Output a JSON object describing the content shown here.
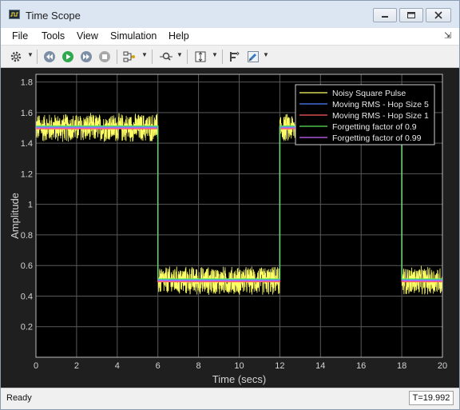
{
  "window": {
    "title": "Time Scope"
  },
  "menu": {
    "items": [
      "File",
      "Tools",
      "View",
      "Simulation",
      "Help"
    ]
  },
  "toolbar": {
    "icons": [
      "gear-icon",
      "step-back-icon",
      "run-icon",
      "step-forward-icon",
      "stop-icon",
      "signal-selector-icon",
      "zoom-icon",
      "scale-axes-icon",
      "cursor-measure-icon",
      "highlight-icon"
    ]
  },
  "status": {
    "left": "Ready",
    "time": "T=19.992"
  },
  "colors": {
    "plot_bg": "#000000",
    "panel_bg": "#1f1f1f",
    "grid": "#5a5a5a",
    "axis_text": "#d4d4d4",
    "noisy": "#ffff66",
    "rms_hop5": "#4f81ff",
    "rms_hop1": "#ff5a5a",
    "forget_09": "#5ce65c",
    "forget_099": "#cc66ff"
  },
  "chart_data": {
    "type": "line",
    "title": "",
    "xlabel": "Time (secs)",
    "ylabel": "Amplitude",
    "xlim": [
      0,
      20
    ],
    "ylim": [
      0,
      1.85
    ],
    "xticks": [
      0,
      2,
      4,
      6,
      8,
      10,
      12,
      14,
      16,
      18,
      20
    ],
    "yticks": [
      0.2,
      0.4,
      0.6,
      0.8,
      1,
      1.2,
      1.4,
      1.6,
      1.8
    ],
    "grid": true,
    "legend_position": "top-right",
    "legend_bg": "#000000",
    "noise_band": 0.1,
    "series": [
      {
        "name": "Noisy Square Pulse",
        "color": "#ffff66",
        "kind": "noisy",
        "x": [
          0,
          6,
          6,
          12,
          12,
          18,
          18,
          20
        ],
        "y": [
          1.5,
          1.5,
          0.5,
          0.5,
          1.5,
          1.5,
          0.5,
          0.5
        ]
      },
      {
        "name": "Moving RMS - Hop Size 5",
        "color": "#4f81ff",
        "kind": "line",
        "x": [
          0,
          6,
          6,
          12,
          12,
          18,
          18,
          20
        ],
        "y": [
          1.5,
          1.5,
          0.5,
          0.5,
          1.5,
          1.5,
          0.5,
          0.5
        ]
      },
      {
        "name": "Moving RMS - Hop Size 1",
        "color": "#ff5a5a",
        "kind": "line",
        "x": [
          0,
          6,
          6,
          12,
          12,
          18,
          18,
          20
        ],
        "y": [
          1.5,
          1.5,
          0.5,
          0.5,
          1.5,
          1.5,
          0.5,
          0.5
        ]
      },
      {
        "name": "Forgetting factor of 0.9",
        "color": "#5ce65c",
        "kind": "line",
        "x": [
          0,
          6,
          6,
          12,
          12,
          18,
          18,
          20
        ],
        "y": [
          1.5,
          1.5,
          0.5,
          0.5,
          1.5,
          1.5,
          0.5,
          0.5
        ]
      },
      {
        "name": "Forgetting factor of 0.99",
        "color": "#cc66ff",
        "kind": "line",
        "x": [
          0,
          6,
          6,
          12,
          12,
          18,
          18,
          20
        ],
        "y": [
          1.5,
          1.5,
          0.5,
          0.5,
          1.5,
          1.5,
          0.5,
          0.5
        ]
      }
    ]
  }
}
